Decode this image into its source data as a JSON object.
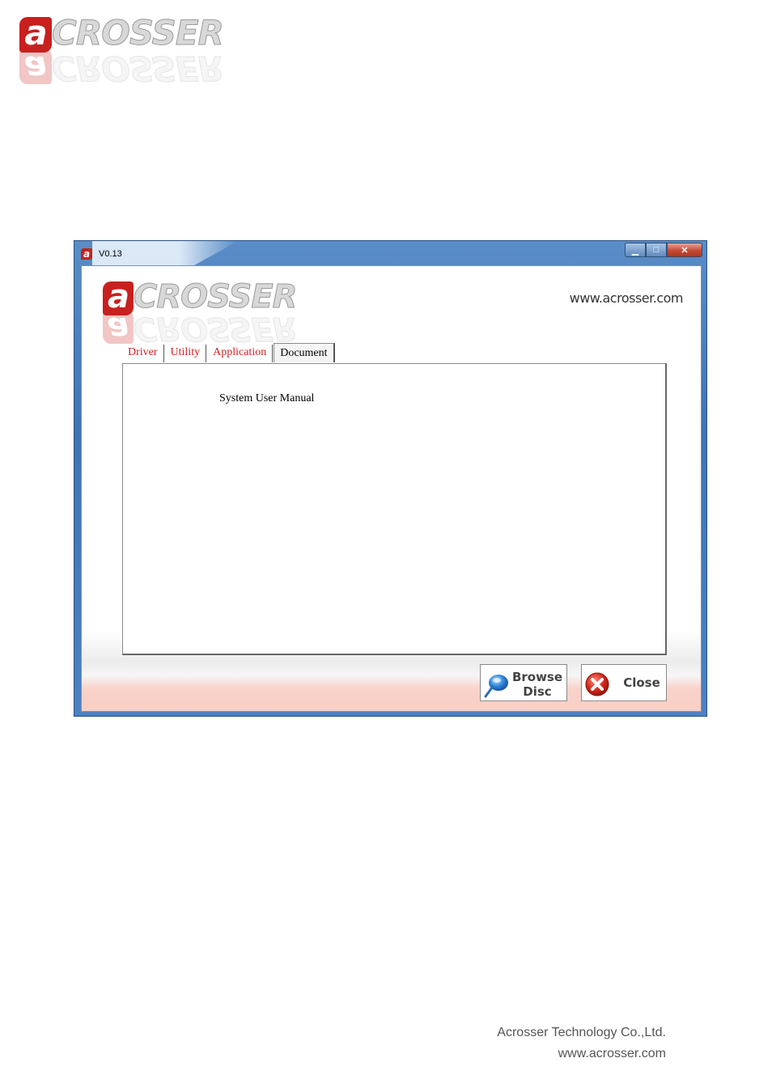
{
  "page": {
    "logo": {
      "a": "a",
      "rest": "CROSSER"
    },
    "footer": {
      "company": "Acrosser Technology Co.,Ltd.",
      "url": "www.acrosser.com"
    }
  },
  "window": {
    "title": "V0.13",
    "controls": {
      "minimize": "▁",
      "maximize": "□",
      "close": "✕"
    },
    "header": {
      "logo": {
        "a": "a",
        "rest": "CROSSER"
      },
      "url": "www.acrosser.com"
    },
    "tabs": [
      {
        "label": "Driver",
        "active": false
      },
      {
        "label": "Utility",
        "active": false
      },
      {
        "label": "Application",
        "active": false
      },
      {
        "label": "Document",
        "active": true
      }
    ],
    "document_items": [
      "System User Manual"
    ],
    "buttons": {
      "browse": {
        "line1": "Browse",
        "line2": "Disc",
        "icon": "search-disc-icon"
      },
      "close": {
        "label": "Close",
        "icon": "close-x-icon"
      }
    },
    "colors": {
      "brand_red": "#c8201e",
      "tab_text_red": "#d42020"
    }
  }
}
